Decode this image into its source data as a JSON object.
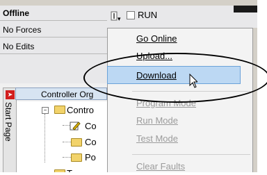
{
  "status": {
    "mode": "Offline",
    "forces": "No Forces",
    "edits": "No Edits",
    "run_label": "RUN"
  },
  "menu": {
    "items": [
      {
        "label": "Go Online",
        "enabled": true
      },
      {
        "label": "Upload...",
        "enabled": true
      },
      {
        "label": "Download",
        "enabled": true,
        "highlighted": true
      },
      {
        "label": "Program Mode",
        "enabled": false
      },
      {
        "label": "Run Mode",
        "enabled": false
      },
      {
        "label": "Test Mode",
        "enabled": false
      },
      {
        "label": "Clear Faults",
        "enabled": false
      }
    ]
  },
  "organizer": {
    "title": "Controller Org",
    "start_page_label": "Start Page",
    "tree": [
      "Contro",
      "Co",
      "Co",
      "Po",
      "T"
    ]
  },
  "colors": {
    "highlight": "#bcd8f3",
    "disabled_text": "#9b9b9b",
    "folder": "#f2d36b"
  }
}
